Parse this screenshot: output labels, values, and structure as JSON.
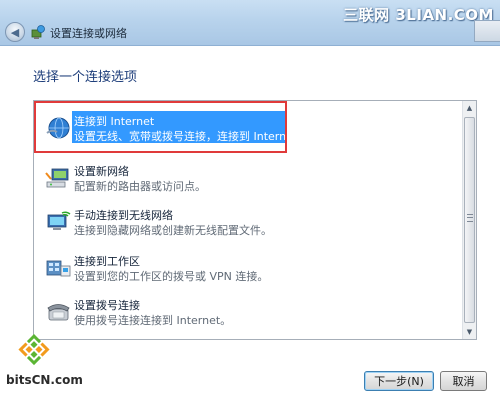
{
  "window": {
    "title": "设置连接或网络",
    "watermark": "三联网 3LIAN.COM"
  },
  "main": {
    "heading": "选择一个连接选项",
    "options": [
      {
        "label": "连接到 Internet",
        "desc": "设置无线、宽带或拨号连接，连接到 Internet。",
        "icon": "globe-network-icon",
        "selected": true
      },
      {
        "label": "设置新网络",
        "desc": "配置新的路由器或访问点。",
        "icon": "router-network-icon",
        "selected": false
      },
      {
        "label": "手动连接到无线网络",
        "desc": "连接到隐藏网络或创建新无线配置文件。",
        "icon": "wireless-computer-icon",
        "selected": false
      },
      {
        "label": "连接到工作区",
        "desc": "设置到您的工作区的拨号或 VPN 连接。",
        "icon": "workplace-vpn-icon",
        "selected": false
      },
      {
        "label": "设置拨号连接",
        "desc": "使用拨号连接连接到 Internet。",
        "icon": "dialup-phone-icon",
        "selected": false
      }
    ]
  },
  "buttons": {
    "next": "下一步(N)",
    "cancel": "取消"
  },
  "branding": {
    "bottom_logo": "bitsCN.com"
  },
  "colors": {
    "selection": "#3399ff",
    "highlight_frame": "#e03a3a",
    "heading": "#1d3d7a"
  }
}
